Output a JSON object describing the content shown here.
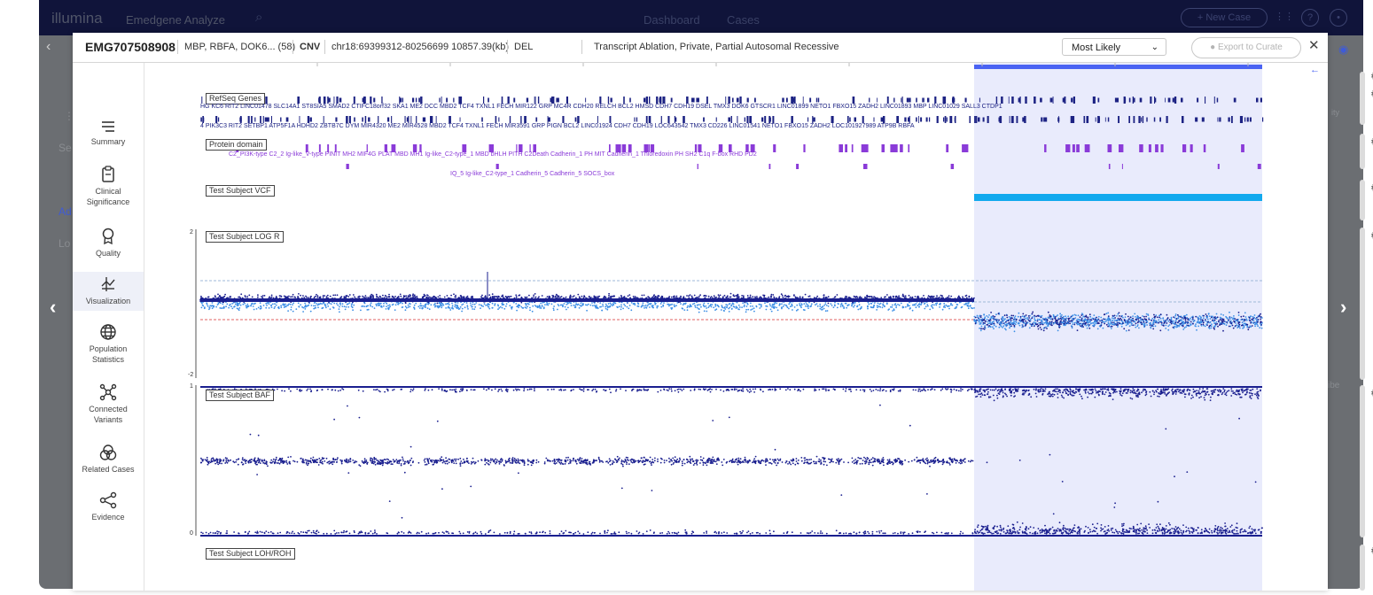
{
  "background_app": {
    "brand": "illumina",
    "product": "Emedgene Analyze",
    "nav": [
      "Dashboard",
      "Cases"
    ],
    "new_case_label": "+ New Case",
    "left_fragments": [
      "Ad",
      "Lo",
      "Se"
    ],
    "right_fragments": [
      "ity",
      "ibe"
    ]
  },
  "header": {
    "case_id": "EMG707508908",
    "genes": "MBP, RBFA, DOK6... (58)",
    "variant_type": "CNV",
    "location": "chr18:69399312-80256699 10857.39(kb)",
    "event": "DEL",
    "tags": "Transcript Ablation, Private, Partial Autosomal Recessive",
    "likely_select": "Most Likely",
    "export_label": "Export to Curate",
    "close_symbol": "✕"
  },
  "sidebar": {
    "items": [
      {
        "label": "Summary",
        "icon": "menu-icon"
      },
      {
        "label": "Clinical Significance",
        "icon": "clipboard-icon"
      },
      {
        "label": "Quality",
        "icon": "badge-icon"
      },
      {
        "label": "Visualization",
        "icon": "visualization-icon",
        "active": true
      },
      {
        "label": "Population Statistics",
        "icon": "globe-icon"
      },
      {
        "label": "Connected Variants",
        "icon": "network-icon"
      },
      {
        "label": "Related Cases",
        "icon": "circles-icon"
      },
      {
        "label": "Evidence",
        "icon": "share-icon"
      }
    ]
  },
  "tracks": {
    "refseq_label": "RefSeq Genes",
    "protein_label": "Protein domain",
    "vcf_label": "Test Subject VCF",
    "logr_label": "Test Subject LOG R",
    "baf_label": "Test Subject BAF",
    "loh_label": "Test Subject LOH/ROH",
    "logr_axis": {
      "max": "2",
      "min": "-2"
    },
    "baf_axis": {
      "max": "1",
      "min": "0"
    },
    "genes_row1": "HG   KC6          RIT2     LINC01478  SLC14A1 ST8SIA5  SMAD2  CTIFC18orf32 SKA1 ME2      DCC      MBD2   TCF4    TXNL1  FECH  MIR122  GRP    MC4R   CDH20 RELCH  BCL2  HMSD      CDH7 CDH19  DSEL    TMX3   DOK6  GTSCR1 LINC01899  NETO1    FBXO15  ZADH2 LINC01893 MBP LINC01029 SALL3 CTDP1",
    "genes_row2": "4              PIK3C3  RIT2        SETBP1  ATP5F1A  HDHD2  ZBTB7C  DYM  MIR4320  ME2      MIR4528  MBD2   TCF4    TXNL1  FECH  MIR3591  GRP          PIGN       BCL2  LINC01924    CDH7 CDH19 LOC643542 TMX3   CD226     LINC01541   NETO1    FBXO15  ZADH2 LOC101927989        ATP9B  RBFA",
    "domains_row1": "C2_PI3K-type   C2_2          Ig-like_V-type PINIT    MH2   MIF4G  PLAT  MBD  MH1   Ig-like_C2-type_1    MBD   bHLH       PITH          C2Death              Cadherin_1      PH   MIT            Cadherin_1            Thioredoxin  PH   SH2          C1q       F-box                                   RHD  PD2",
    "domains_row2": "IQ_5                                            Ig-like_C2-type_1                Cadherin_5                  Cadherin_5                 SOCS_box"
  },
  "colors": {
    "accent": "#4a63f3",
    "dark_point": "#1a1f8f",
    "light_point": "#3d8fe6",
    "vcf_bar": "#12a9ee",
    "gene": "#1c2283",
    "domain": "#8a3bd8",
    "highlight": "#c4cbf6",
    "dup_line": "#9fb8d8",
    "del_line": "#e06060"
  }
}
